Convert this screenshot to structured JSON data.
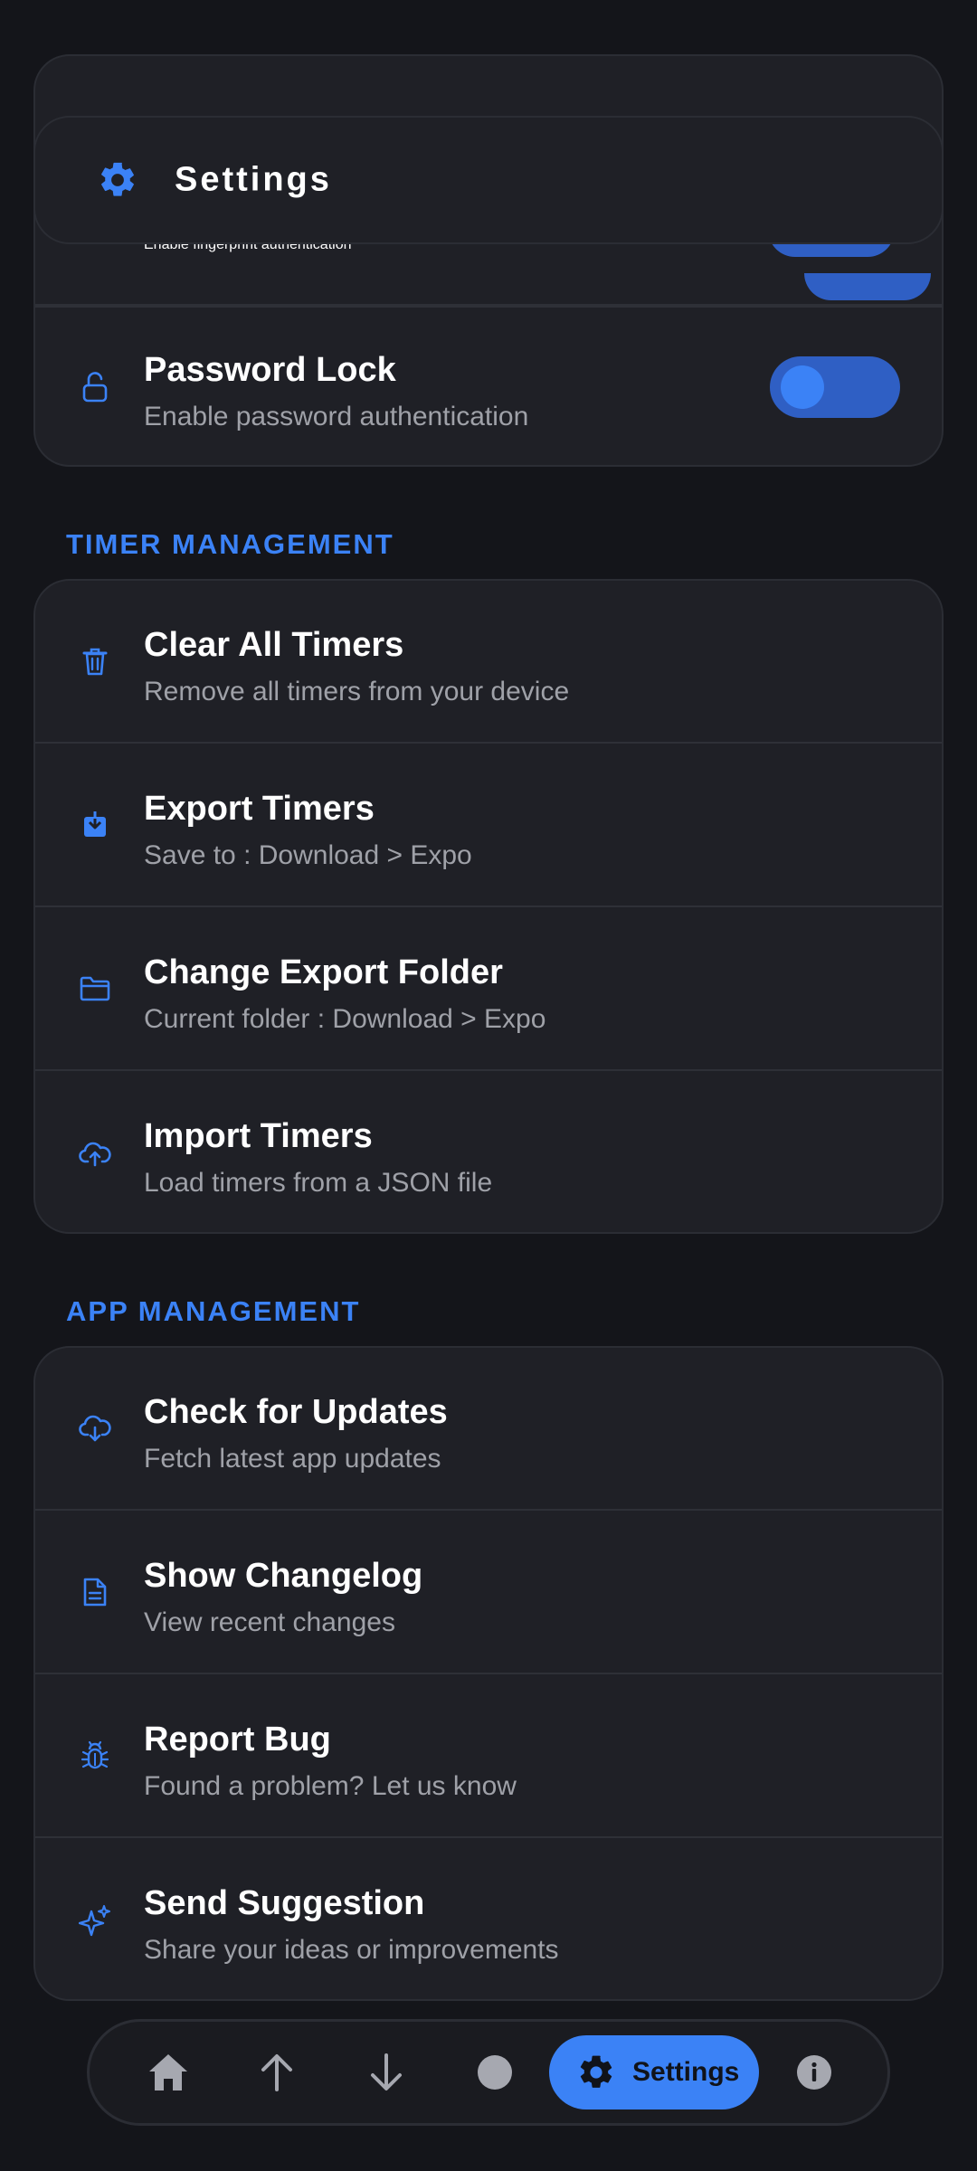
{
  "header": {
    "title": "Settings",
    "icon": "gear-icon"
  },
  "security": {
    "partial_row": {
      "subtitle": "Enable fingerprint authentication"
    },
    "password_lock": {
      "title": "Password Lock",
      "subtitle": "Enable password authentication",
      "icon": "unlock-icon",
      "enabled": false
    }
  },
  "timer_management": {
    "label": "TIMER MANAGEMENT",
    "items": [
      {
        "title": "Clear All Timers",
        "subtitle": "Remove all timers from your device",
        "icon": "trash-icon"
      },
      {
        "title": "Export Timers",
        "subtitle": "Save to :  Download > Expo",
        "icon": "download-icon"
      },
      {
        "title": "Change Export Folder",
        "subtitle": "Current folder :  Download > Expo",
        "icon": "folder-icon"
      },
      {
        "title": "Import Timers",
        "subtitle": "Load timers from a JSON file",
        "icon": "cloud-upload-icon"
      }
    ]
  },
  "app_management": {
    "label": "APP MANAGEMENT",
    "items": [
      {
        "title": "Check for Updates",
        "subtitle": "Fetch latest app updates",
        "icon": "cloud-download-icon"
      },
      {
        "title": "Show Changelog",
        "subtitle": "View recent changes",
        "icon": "document-icon"
      },
      {
        "title": "Report Bug",
        "subtitle": "Found a problem? Let us know",
        "icon": "bug-icon"
      },
      {
        "title": "Send Suggestion",
        "subtitle": "Share your ideas or improvements",
        "icon": "sparkles-icon"
      }
    ]
  },
  "bottom_nav": {
    "items": [
      "home-icon",
      "arrow-up-icon",
      "arrow-down-icon",
      "circle-icon",
      "gear-icon",
      "info-icon"
    ],
    "active_label": "Settings"
  },
  "colors": {
    "accent": "#3b82f6",
    "background": "#14151a",
    "card": "#1f2026",
    "subtitle": "#9fa1a8"
  }
}
